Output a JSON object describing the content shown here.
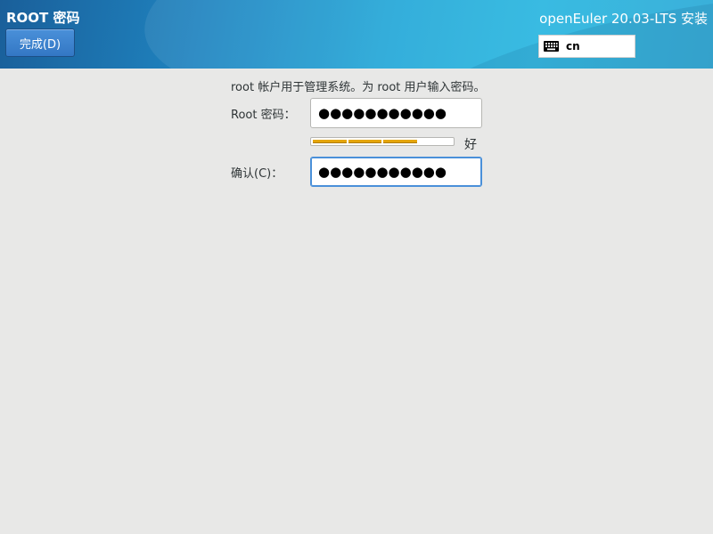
{
  "header": {
    "spoke_title": "ROOT 密码",
    "done_label": "完成(D)",
    "product_title": "openEuler 20.03-LTS 安装",
    "keyboard_layout": "cn"
  },
  "form": {
    "description": "root 帐户用于管理系统。为 root 用户输入密码。",
    "password_label": "Root 密码：",
    "password_value": "●●●●●●●●●●●",
    "strength_label": "好",
    "strength_fraction": 0.75,
    "strength_color": "#e5a50a",
    "confirm_label": "确认(C)：",
    "confirm_value": "●●●●●●●●●●●"
  },
  "colors": {
    "accent": "#4a90d9",
    "background": "#e8e8e7"
  }
}
